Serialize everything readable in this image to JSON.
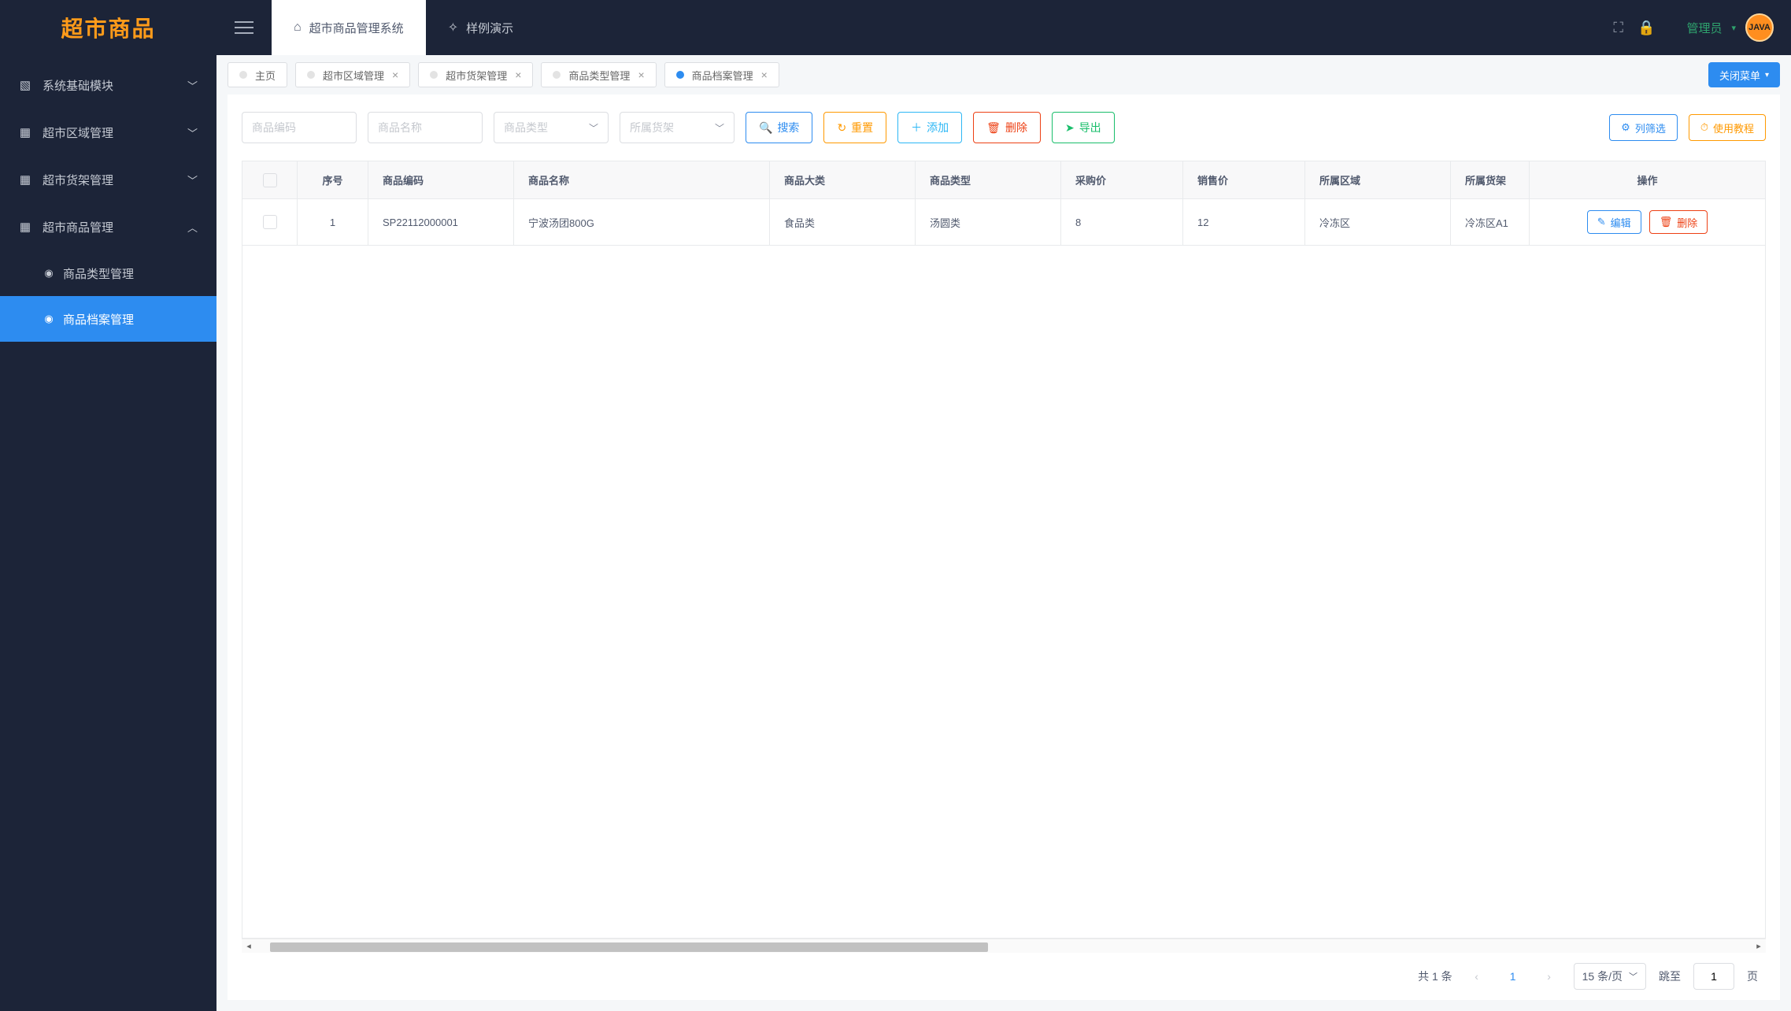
{
  "header": {
    "logo_text": "超市商品",
    "top_tabs": [
      {
        "label": "超市商品管理系统",
        "icon": "home",
        "active": true
      },
      {
        "label": "样例演示",
        "icon": "sparkle",
        "active": false
      }
    ],
    "user_label": "管理员",
    "avatar_text": "JAVA"
  },
  "sidebar": {
    "items": [
      {
        "label": "系统基础模块",
        "icon": "card",
        "expanded": false
      },
      {
        "label": "超市区域管理",
        "icon": "grid",
        "expanded": false
      },
      {
        "label": "超市货架管理",
        "icon": "grid",
        "expanded": false
      },
      {
        "label": "超市商品管理",
        "icon": "grid",
        "expanded": true,
        "children": [
          {
            "label": "商品类型管理",
            "active": false
          },
          {
            "label": "商品档案管理",
            "active": true
          }
        ]
      }
    ]
  },
  "tabs": [
    {
      "label": "主页",
      "closable": false,
      "active": false
    },
    {
      "label": "超市区域管理",
      "closable": true,
      "active": false
    },
    {
      "label": "超市货架管理",
      "closable": true,
      "active": false
    },
    {
      "label": "商品类型管理",
      "closable": true,
      "active": false
    },
    {
      "label": "商品档案管理",
      "closable": true,
      "active": true
    }
  ],
  "close_menu_label": "关闭菜单",
  "filters": {
    "code_placeholder": "商品编码",
    "name_placeholder": "商品名称",
    "type_placeholder": "商品类型",
    "shelf_placeholder": "所属货架"
  },
  "buttons": {
    "search": "搜索",
    "reset": "重置",
    "add": "添加",
    "delete": "删除",
    "export": "导出",
    "column_filter": "列筛选",
    "tutorial": "使用教程",
    "edit_row": "编辑",
    "delete_row": "删除"
  },
  "table": {
    "headers": {
      "idx": "序号",
      "code": "商品编码",
      "name": "商品名称",
      "cat": "商品大类",
      "type": "商品类型",
      "buy": "采购价",
      "sell": "销售价",
      "area": "所属区域",
      "shelf": "所属货架",
      "op": "操作"
    },
    "rows": [
      {
        "idx": "1",
        "code": "SP22112000001",
        "name": "宁波汤团800G",
        "cat": "食品类",
        "type": "汤圆类",
        "buy": "8",
        "sell": "12",
        "area": "冷冻区",
        "shelf": "冷冻区A1"
      }
    ]
  },
  "pager": {
    "total_text": "共 1 条",
    "current": "1",
    "size_label": "15 条/页",
    "goto_label": "跳至",
    "goto_value": "1",
    "page_suffix": "页"
  }
}
